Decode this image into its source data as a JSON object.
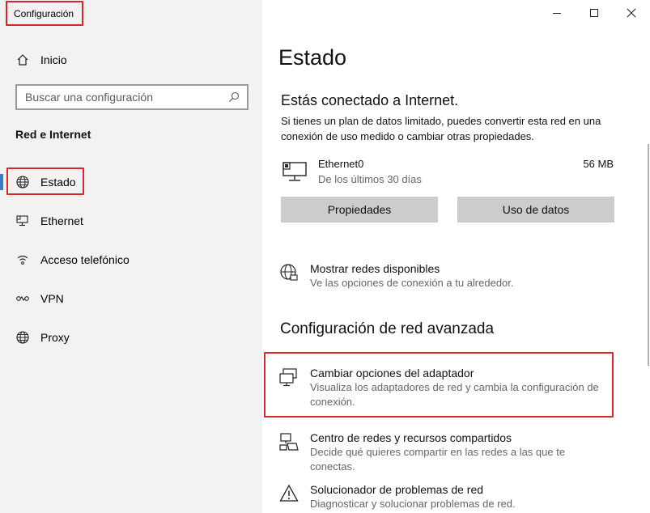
{
  "window": {
    "title": "Configuración",
    "controls": {
      "minimize": "—",
      "maximize": "☐",
      "close": "✕"
    }
  },
  "sidebar": {
    "home": {
      "label": "Inicio",
      "icon": "home-icon"
    },
    "search": {
      "placeholder": "Buscar una configuración",
      "icon": "search-icon"
    },
    "section": "Red e Internet",
    "items": [
      {
        "label": "Estado",
        "icon": "globe-icon",
        "active": true
      },
      {
        "label": "Ethernet",
        "icon": "ethernet-icon",
        "active": false
      },
      {
        "label": "Acceso telefónico",
        "icon": "dialup-icon",
        "active": false
      },
      {
        "label": "VPN",
        "icon": "vpn-icon",
        "active": false
      },
      {
        "label": "Proxy",
        "icon": "globe-icon",
        "active": false
      }
    ]
  },
  "main": {
    "title": "Estado",
    "status_heading": "Estás conectado a Internet.",
    "status_description": "Si tienes un plan de datos limitado, puedes convertir esta red en una conexión de uso medido o cambiar otras propiedades.",
    "connection": {
      "name": "Ethernet0",
      "subtitle": "De los últimos 30 días",
      "usage": "56 MB"
    },
    "buttons": {
      "properties": "Propiedades",
      "data_usage": "Uso de datos"
    },
    "show_networks": {
      "title": "Mostrar redes disponibles",
      "description": "Ve las opciones de conexión a tu alrededor."
    },
    "advanced_title": "Configuración de red avanzada",
    "advanced_links": [
      {
        "title": "Cambiar opciones del adaptador",
        "description": "Visualiza los adaptadores de red y cambia la configuración de conexión."
      },
      {
        "title": "Centro de redes y recursos compartidos",
        "description": "Decide qué quieres compartir en las redes a las que te conectas."
      },
      {
        "title": "Solucionador de problemas de red",
        "description": "Diagnosticar y solucionar problemas de red."
      }
    ]
  },
  "colors": {
    "sidebar_bg": "#f2f2f2",
    "highlight_red": "#d9262b",
    "accent_blue": "#3a7bc8",
    "button_bg": "#cccccc"
  }
}
